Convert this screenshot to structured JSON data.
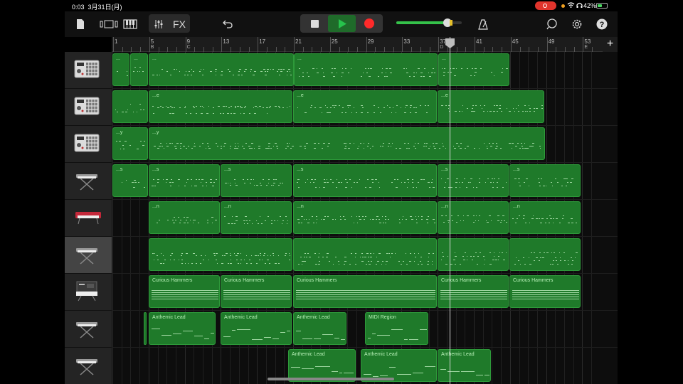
{
  "status": {
    "time": "0:03",
    "date": "3月31日(月)",
    "battery": "42%"
  },
  "toolbar": {
    "buttons": [
      {
        "name": "my-songs-button",
        "icon": "document-icon"
      },
      {
        "name": "view-toggle-button",
        "icon": "tracks-view-icon"
      },
      {
        "name": "browser-button",
        "icon": "keyboard-icon"
      },
      {
        "name": "mixer-button",
        "icon": "sliders-icon"
      },
      {
        "name": "fx-button",
        "label": "FX"
      },
      {
        "name": "undo-button",
        "icon": "undo-icon"
      },
      {
        "name": "stop-button",
        "icon": "stop-icon"
      },
      {
        "name": "play-button",
        "icon": "play-icon"
      },
      {
        "name": "record-button",
        "icon": "record-icon"
      },
      {
        "name": "metronome-button",
        "icon": "metronome-icon"
      },
      {
        "name": "loop-browser-button",
        "icon": "loop-icon"
      },
      {
        "name": "settings-button",
        "icon": "gear-icon"
      },
      {
        "name": "help-button",
        "icon": "question-icon"
      }
    ],
    "fx_label": "FX",
    "master_volume": 0.78,
    "colors": {
      "play": "#27c24c",
      "record": "#ff2a2a",
      "volume": "#35c24a"
    }
  },
  "ruler": {
    "bars": [
      "1",
      "5",
      "9",
      "13",
      "17",
      "21",
      "25",
      "29",
      "33",
      "37",
      "41",
      "45",
      "49",
      "53"
    ],
    "sections": [
      "B",
      "C",
      "D",
      "E"
    ]
  },
  "tracks": [
    {
      "instrument": "drum-machine-icon",
      "selected": false,
      "regions": [
        {
          "name": "..."
        },
        {
          "name": "..."
        },
        {
          "name": "..."
        },
        {
          "name": "..."
        },
        {
          "name": "..."
        }
      ]
    },
    {
      "instrument": "drum-machine-icon",
      "selected": false,
      "regions": [
        {
          "name": ""
        },
        {
          "name": "...e"
        },
        {
          "name": "...e"
        },
        {
          "name": "...e"
        }
      ]
    },
    {
      "instrument": "drum-machine-icon",
      "selected": false,
      "regions": [
        {
          "name": "...y"
        },
        {
          "name": "...y"
        }
      ]
    },
    {
      "instrument": "keyboard-stand-icon",
      "selected": false,
      "regions": [
        {
          "name": "...s"
        },
        {
          "name": "...s"
        },
        {
          "name": "...s"
        },
        {
          "name": "...s"
        },
        {
          "name": "...s"
        },
        {
          "name": "...s"
        }
      ]
    },
    {
      "instrument": "red-synth-icon",
      "selected": false,
      "regions": [
        {
          "name": "...n"
        },
        {
          "name": "...n"
        },
        {
          "name": "...n"
        },
        {
          "name": "...n"
        },
        {
          "name": "...n"
        }
      ]
    },
    {
      "instrument": "keyboard-stand-icon",
      "selected": true,
      "regions": [
        {
          "name": ""
        },
        {
          "name": ""
        },
        {
          "name": ""
        },
        {
          "name": ""
        }
      ]
    },
    {
      "instrument": "analog-synth-icon",
      "selected": false,
      "regions": [
        {
          "name": "Curious Hammers"
        },
        {
          "name": "Curious Hammers"
        },
        {
          "name": "Curious Hammers"
        },
        {
          "name": "Curious Hammers"
        },
        {
          "name": "Curious Hammers"
        }
      ]
    },
    {
      "instrument": "keyboard-stand-icon",
      "selected": false,
      "regions": [
        {
          "name": ""
        },
        {
          "name": "Anthemic Lead"
        },
        {
          "name": "Anthemic Lead"
        },
        {
          "name": "Anthemic Lead"
        },
        {
          "name": "MIDI Region"
        }
      ]
    },
    {
      "instrument": "keyboard-stand-icon",
      "selected": false,
      "regions": [
        {
          "name": "Anthemic Lead"
        },
        {
          "name": "Anthemic Lead"
        },
        {
          "name": "Anthemic Lead"
        }
      ]
    }
  ]
}
